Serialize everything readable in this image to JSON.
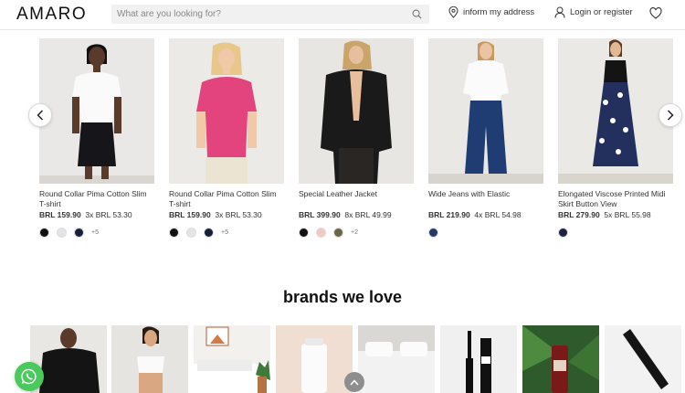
{
  "header": {
    "logo": "AMARO",
    "search_placeholder": "What are you looking for?",
    "address_label": "inform my address",
    "login_label": "Login or register"
  },
  "products": [
    {
      "name": "Round Collar Pima Cotton Slim T-shirt",
      "price": "BRL 159.90",
      "installments": "3x BRL 53.30",
      "swatches": [
        "#111111",
        "#e4e4e8",
        "#15213a"
      ],
      "more": "+5"
    },
    {
      "name": "Round Collar Pima Cotton Slim T-shirt",
      "price": "BRL 159.90",
      "installments": "3x BRL 53.30",
      "swatches": [
        "#111111",
        "#e4e4e8",
        "#15213a"
      ],
      "more": "+5"
    },
    {
      "name": "Special Leather Jacket",
      "price": "BRL 399.90",
      "installments": "8x BRL 49.99",
      "swatches": [
        "#111111",
        "#f1c9c0",
        "#6b6648"
      ],
      "more": "+2"
    },
    {
      "name": "Wide Jeans with Elastic",
      "price": "BRL 219.90",
      "installments": "4x BRL 54.98",
      "swatches": [
        "#233b63"
      ],
      "more": ""
    },
    {
      "name": "Elongated Viscose Printed Midi Skirt Button View",
      "price": "BRL 279.90",
      "installments": "5x BRL 55.98",
      "swatches": [
        "#1d2340"
      ],
      "more": ""
    }
  ],
  "brands_title": "brands we love",
  "colors": {
    "whatsapp": "#4ac95d",
    "pink_tee": "#e4447d"
  }
}
